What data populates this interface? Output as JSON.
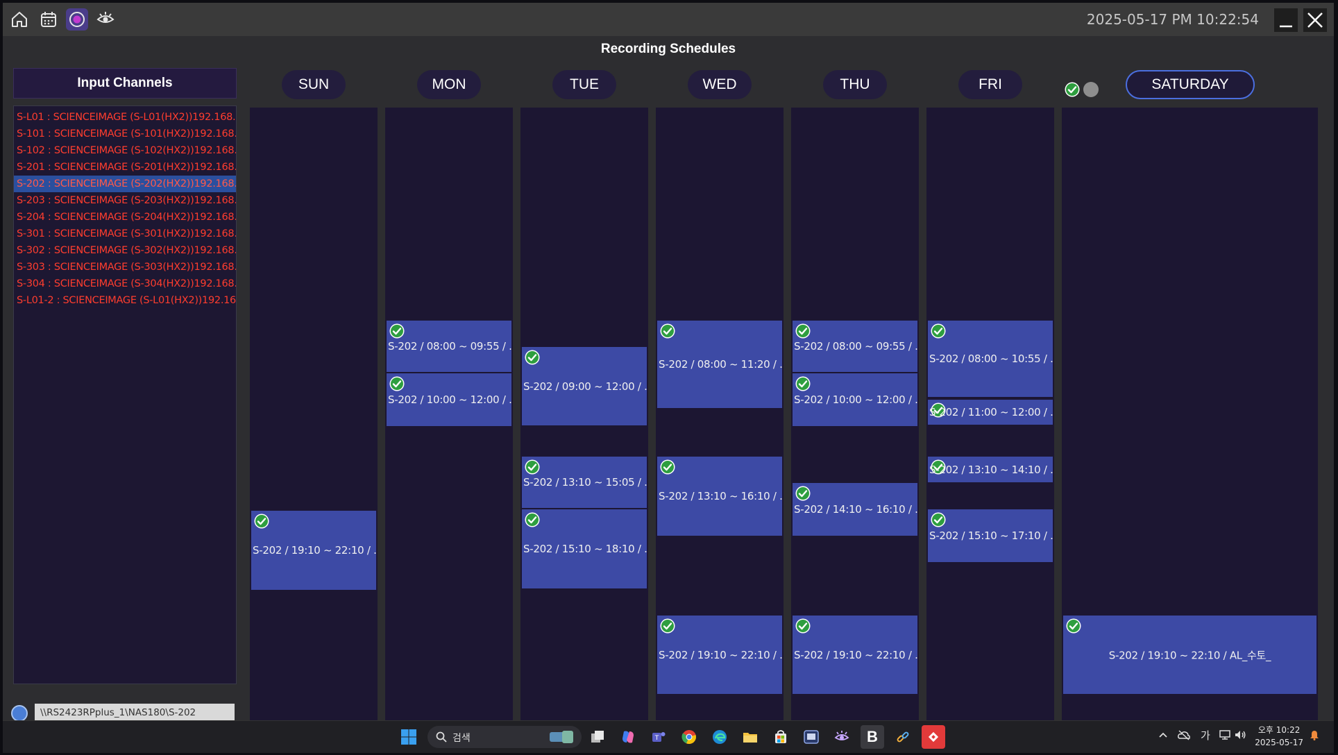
{
  "header": {
    "datetime": "2025-05-17 PM 10:22:54",
    "title": "Recording Schedules"
  },
  "channels": {
    "header": "Input Channels",
    "items": [
      {
        "label": "S-L01 : SCIENCEIMAGE (S-L01(HX2))192.168."
      },
      {
        "label": "S-101 : SCIENCEIMAGE (S-101(HX2))192.168."
      },
      {
        "label": "S-102 : SCIENCEIMAGE (S-102(HX2))192.168."
      },
      {
        "label": "S-201 : SCIENCEIMAGE (S-201(HX2))192.168."
      },
      {
        "label": "S-202 : SCIENCEIMAGE (S-202(HX2))192.168."
      },
      {
        "label": "S-203 : SCIENCEIMAGE (S-203(HX2))192.168."
      },
      {
        "label": "S-204 : SCIENCEIMAGE (S-204(HX2))192.168."
      },
      {
        "label": "S-301 : SCIENCEIMAGE (S-301(HX2))192.168."
      },
      {
        "label": "S-302 : SCIENCEIMAGE (S-302(HX2))192.168."
      },
      {
        "label": "S-303 : SCIENCEIMAGE (S-303(HX2))192.168."
      },
      {
        "label": "S-304 : SCIENCEIMAGE (S-304(HX2))192.168."
      },
      {
        "label": "S-L01-2 : SCIENCEIMAGE (S-L01(HX2))192.16"
      }
    ],
    "selected_index": 4
  },
  "path": {
    "value": "\\\\RS2423RPplus_1\\NAS180\\S-202"
  },
  "days": {
    "sun": "SUN",
    "mon": "MON",
    "tue": "TUE",
    "wed": "WED",
    "thu": "THU",
    "fri": "FRI",
    "sat": "SATURDAY"
  },
  "schedules": {
    "sun": [
      {
        "label": "S-202 / 19:10 ~ 22:10 / ..."
      }
    ],
    "mon": [
      {
        "label": "S-202 / 08:00 ~ 09:55 / ..."
      },
      {
        "label": "S-202 / 10:00 ~ 12:00 / ..."
      }
    ],
    "tue": [
      {
        "label": "S-202 / 09:00 ~ 12:00 / ..."
      },
      {
        "label": "S-202 / 13:10 ~ 15:05 / ..."
      },
      {
        "label": "S-202 / 15:10 ~ 18:10 / ..."
      }
    ],
    "wed": [
      {
        "label": "S-202 / 08:00 ~ 11:20 / ..."
      },
      {
        "label": "S-202 / 13:10 ~ 16:10 / ..."
      },
      {
        "label": "S-202 / 19:10 ~ 22:10 / ..."
      }
    ],
    "thu": [
      {
        "label": "S-202 / 08:00 ~ 09:55 / ..."
      },
      {
        "label": "S-202 / 10:00 ~ 12:00 / ..."
      },
      {
        "label": "S-202 / 14:10 ~ 16:10 / ..."
      },
      {
        "label": "S-202 / 19:10 ~ 22:10 / ..."
      }
    ],
    "fri": [
      {
        "label": "S-202 / 08:00 ~ 10:55 / ..."
      },
      {
        "label": "S-202 / 11:00 ~ 12:00 / ..."
      },
      {
        "label": "S-202 / 13:10 ~ 14:10 / ..."
      },
      {
        "label": "S-202 / 15:10 ~ 17:10 / ..."
      }
    ],
    "sat": [
      {
        "label": "S-202 / 19:10 ~ 22:10 / AL_수토_"
      }
    ]
  },
  "taskbar": {
    "search_placeholder": "검색",
    "ime": "가",
    "clock_time": "오후 10:22",
    "clock_date": "2025-05-17",
    "active_app": "B"
  },
  "colors": {
    "event_fill": "#3d4aa5",
    "column_fill": "#1c1632",
    "channel_text": "#ff3d2e",
    "check_green": "#2e9e3f",
    "selected_row": "#2b4f9e"
  }
}
